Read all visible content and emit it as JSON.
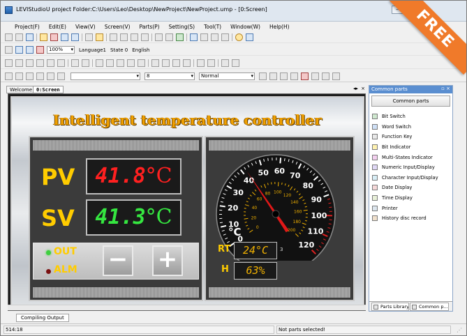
{
  "window": {
    "title": "LEVIStudioU  project Folder:C:\\Users\\Leo\\Desktop\\NewProject\\NewProject.ump - [0:Screen]"
  },
  "ribbon": "FREE",
  "menu": [
    "Project(F)",
    "Edit(E)",
    "View(V)",
    "Screen(V)",
    "Parts(P)",
    "Setting(S)",
    "Tool(T)",
    "Window(W)",
    "Help(H)"
  ],
  "toolbar2": {
    "zoom": "100%",
    "language": "Language1",
    "state": "State 0",
    "locale": "English"
  },
  "toolbar4": {
    "font_size": "8",
    "font_style": "Normal"
  },
  "doc_tabs": [
    "Welcome",
    "0:Screen"
  ],
  "hmi": {
    "title": "Intelligent temperature controller",
    "pv_label": "PV",
    "pv_value": "41.8",
    "sv_label": "SV",
    "sv_value": "41.3",
    "unit": "°C",
    "out_label": "OUT",
    "alm_label": "ALM",
    "minus": "−",
    "plus": "+",
    "rt_label": "RT",
    "rt_value": "24°C",
    "h_label": "H",
    "h_value": "63%",
    "gauge_unit": "°C",
    "gauge_outer": [
      "0",
      "10",
      "20",
      "30",
      "40",
      "50",
      "60",
      "70",
      "80",
      "90",
      "100",
      "110",
      "120"
    ],
    "gauge_inner": [
      "0",
      "20",
      "40",
      "60",
      "80",
      "100",
      "120",
      "140",
      "160",
      "180",
      "200"
    ],
    "gauge_value": 42,
    "gauge_small": "3",
    "colors": {
      "accent": "#ffcc00",
      "red_lcd": "#ff2020",
      "green_lcd": "#35e640"
    }
  },
  "sidebar": {
    "header": "Common parts",
    "button": "Common parts",
    "items": [
      "Bit Switch",
      "Word Switch",
      "Function Key",
      "Bit Indicator",
      "Multi-States Indicator",
      "Numeric Input/Display",
      "Character Input/Display",
      "Date Display",
      "Time Display",
      "Printer",
      "History disc record"
    ],
    "tabs": [
      "Parts Library",
      "Common p..."
    ]
  },
  "bottom_tab": "Compiling Output",
  "status": {
    "coords": "514:18",
    "message": "Not parts selected!"
  }
}
